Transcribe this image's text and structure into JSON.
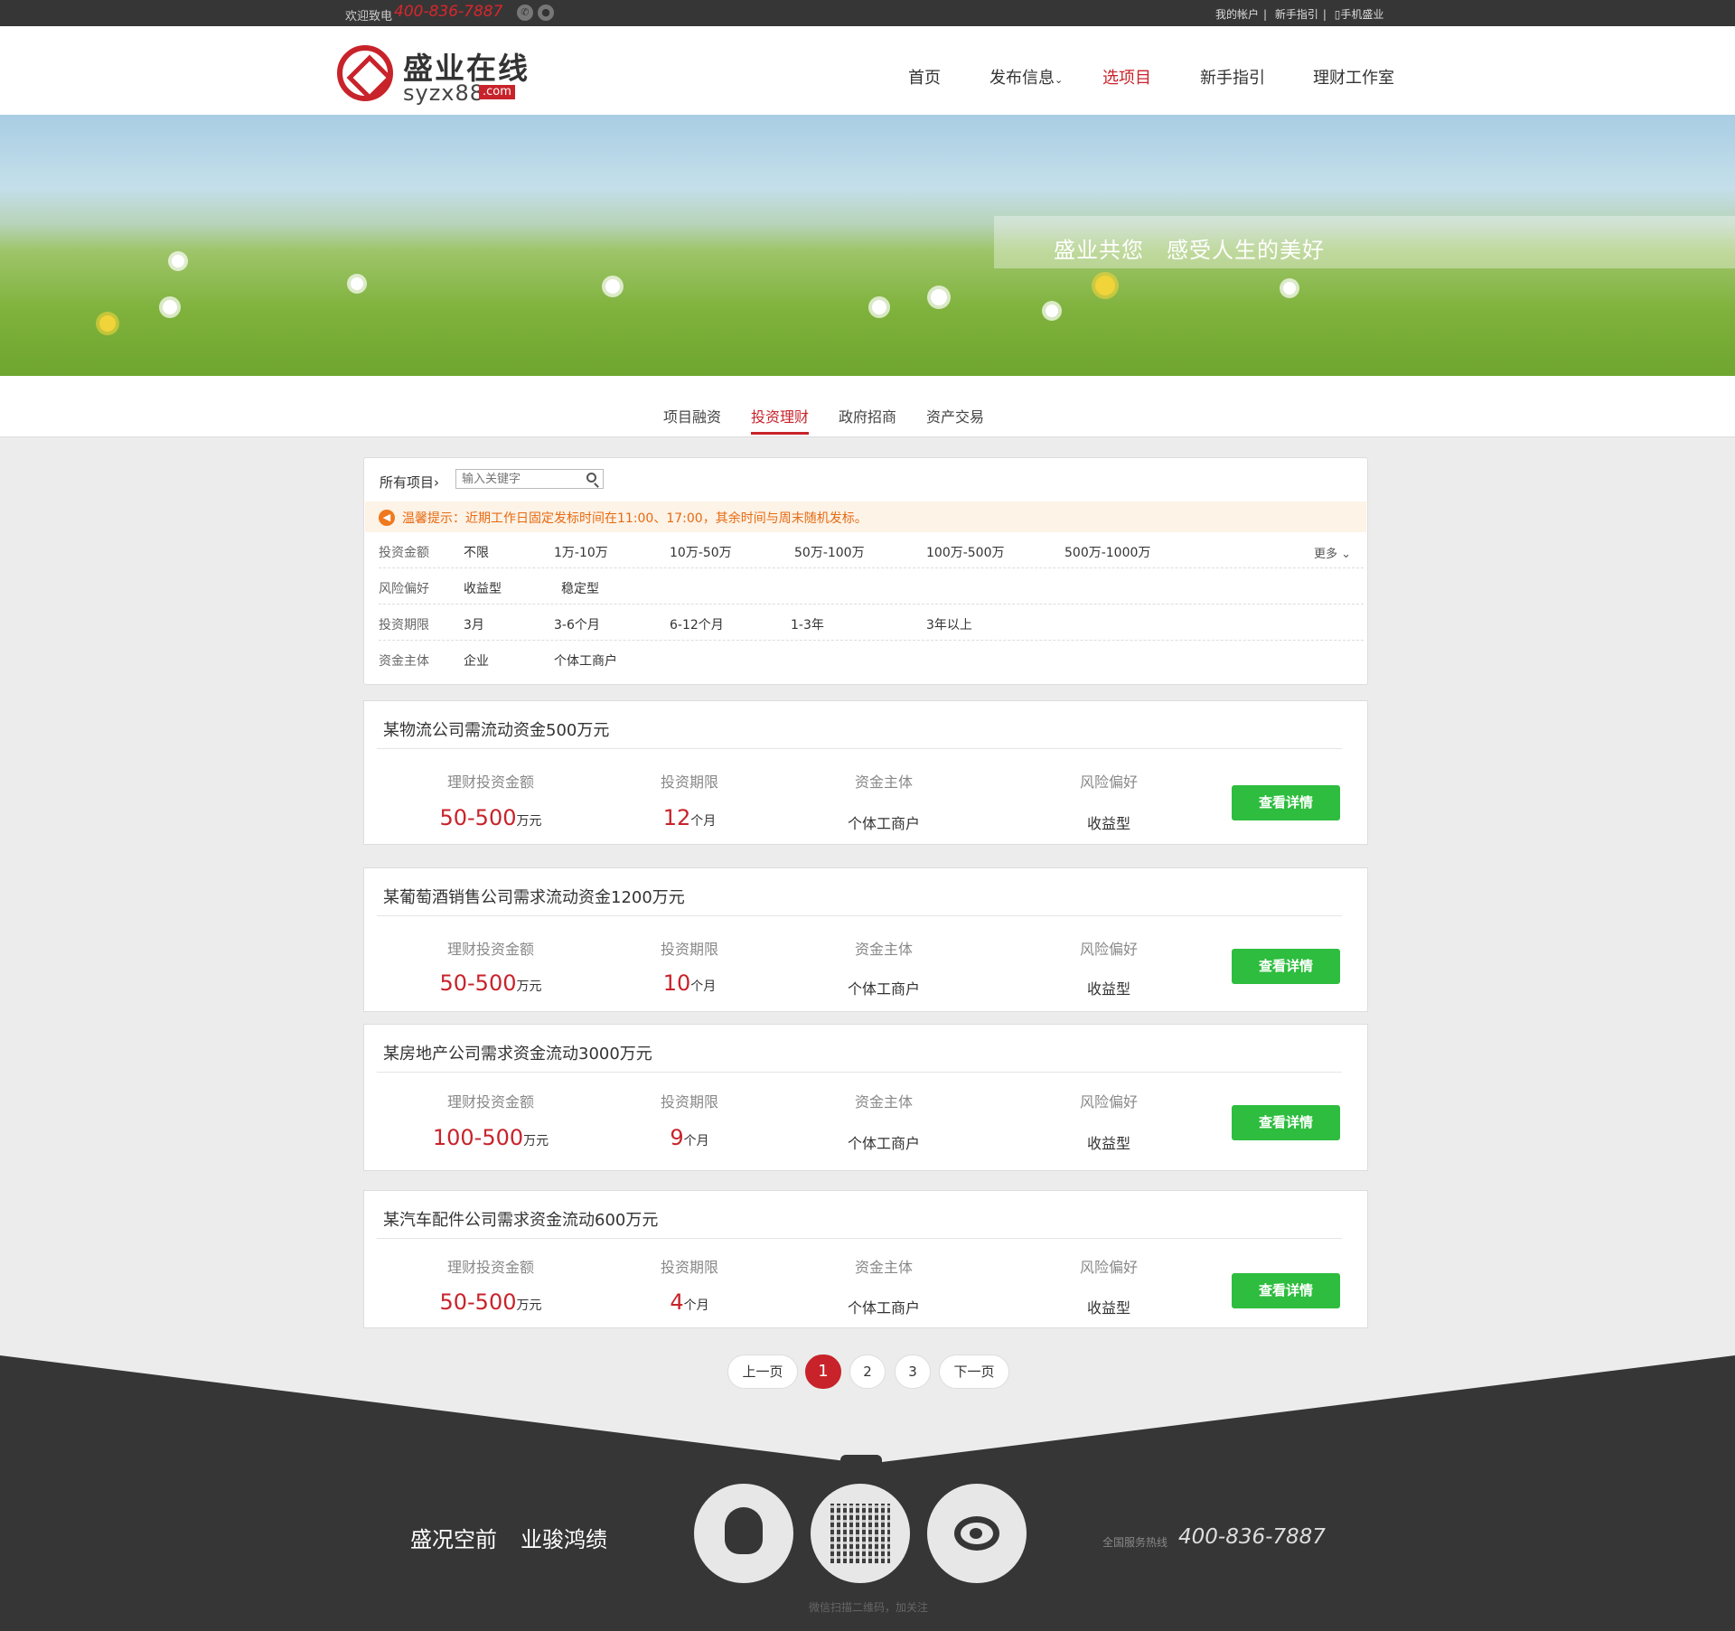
{
  "topbar": {
    "welcome": "欢迎致电",
    "phone": "400-836-7887",
    "links": [
      "我的帐户",
      "新手指引",
      "手机盛业"
    ]
  },
  "header": {
    "logo_cn": "盛业在线",
    "logo_en": "syzx88",
    "logo_com": ".com",
    "nav": [
      "首页",
      "发布信息",
      "选项目",
      "新手指引",
      "理财工作室"
    ]
  },
  "banner": {
    "slogan": "盛业共您　感受人生的美好"
  },
  "tabs": [
    "项目融资",
    "投资理财",
    "政府招商",
    "资产交易"
  ],
  "filter": {
    "all_projects": "所有项目",
    "search_placeholder": "输入关键字",
    "notice": "温馨提示：近期工作日固定发标时间在11:00、17:00，其余时间与周末随机发标。",
    "more": "更多",
    "rows": [
      {
        "label": "投资金额",
        "options": [
          "不限",
          "1万-10万",
          "10万-50万",
          "50万-100万",
          "100万-500万",
          "500万-1000万"
        ]
      },
      {
        "label": "风险偏好",
        "options": [
          "收益型",
          "稳定型"
        ]
      },
      {
        "label": "投资期限",
        "options": [
          "3月",
          "3-6个月",
          "6-12个月",
          "1-3年",
          "3年以上"
        ]
      },
      {
        "label": "资金主体",
        "options": [
          "企业",
          "个体工商户"
        ]
      }
    ]
  },
  "labels": {
    "amount": "理财投资金额",
    "term": "投资期限",
    "subject": "资金主体",
    "risk": "风险偏好",
    "wan": "万元",
    "month": "个月",
    "detail": "查看详情"
  },
  "projects": [
    {
      "title": "某物流公司需流动资金500万元",
      "amount": "50-500",
      "term": "12",
      "subject": "个体工商户",
      "risk": "收益型"
    },
    {
      "title": "某葡萄酒销售公司需求流动资金1200万元",
      "amount": "50-500",
      "term": "10",
      "subject": "个体工商户",
      "risk": "收益型"
    },
    {
      "title": "某房地产公司需求资金流动3000万元",
      "amount": "100-500",
      "term": "9",
      "subject": "个体工商户",
      "risk": "收益型"
    },
    {
      "title": "某汽车配件公司需求资金流动600万元",
      "amount": "50-500",
      "term": "4",
      "subject": "个体工商户",
      "risk": "收益型"
    }
  ],
  "pagination": {
    "prev": "上一页",
    "pages": [
      "1",
      "2",
      "3"
    ],
    "next": "下一页"
  },
  "footer": {
    "slogan_a": "盛况空前",
    "slogan_b": "业骏鸿绩",
    "hotline_label": "全国服务热线",
    "hotline": "400-836-7887",
    "qr_note": "微信扫描二维码，加关注"
  },
  "colors": {
    "brand_red": "#c8232b",
    "green_button": "#2ebd3f",
    "dark": "#363636"
  }
}
